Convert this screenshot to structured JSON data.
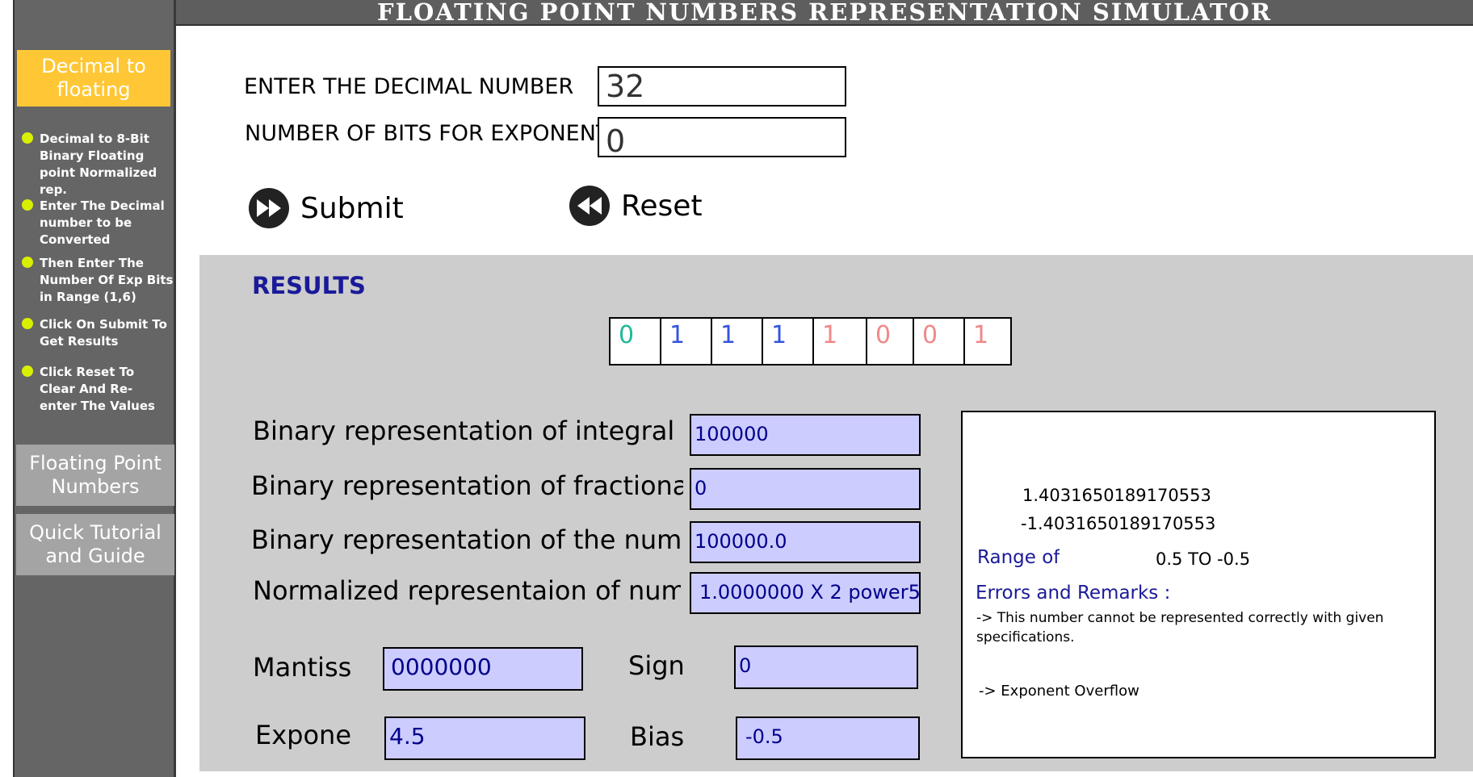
{
  "header": {
    "title": "FLOATING POINT  NUMBERS REPRESENTATION SIMULATOR"
  },
  "sidebar": {
    "active_nav": "Decimal to floating",
    "steps": [
      "Decimal to 8-Bit Binary Floating point Normalized rep.",
      "Enter The Decimal number to be Converted",
      "Then Enter The Number Of  Exp Bits in Range (1,6)",
      "Click On Submit To Get Results",
      "Click Reset To Clear And Re-enter The Values"
    ],
    "nav_floating": "Floating  Point Numbers",
    "nav_tutorial": "Quick Tutorial and Guide"
  },
  "form": {
    "decimal_label": "ENTER THE DECIMAL NUMBER",
    "decimal_value": "32",
    "exp_bits_label": "NUMBER OF BITS FOR EXPONENT",
    "exp_bits_value": "0",
    "submit_label": "Submit",
    "reset_label": "Reset"
  },
  "results": {
    "title": "RESULTS",
    "bits": [
      "0",
      "1",
      "1",
      "1",
      "1",
      "0",
      "0",
      "1"
    ],
    "bit_colors": [
      "#20b89a",
      "#3355dd",
      "#3355dd",
      "#3355dd",
      "#f08888",
      "#f08888",
      "#f08888",
      "#f08888"
    ],
    "binary_integral_label": "Binary representation of integral",
    "binary_integral_value": "100000",
    "binary_fraction_label": "Binary representation of fractional",
    "binary_fraction_value": "0",
    "binary_number_label": "Binary representation of the number",
    "binary_number_value": "100000.0",
    "normalized_label": "Normalized representaion of number",
    "normalized_value": "1.0000000 X 2 power5",
    "mantissa_label": "Mantiss",
    "mantissa_value": "0000000",
    "sign_label": "Sign",
    "sign_value": "0",
    "exponent_label": "Expone",
    "exponent_value": "4.5",
    "bias_label": "Bias",
    "bias_value": "-0.5"
  },
  "remarks": {
    "max_value": "1.4031650189170553",
    "min_value": "-1.4031650189170553",
    "range_label": "Range of",
    "range_value": "0.5 TO -0.5",
    "errors_title": "Errors and Remarks :",
    "error_1": "-> This number cannot be represented correctly with given specifications.",
    "error_2": "-> Exponent Overflow"
  }
}
